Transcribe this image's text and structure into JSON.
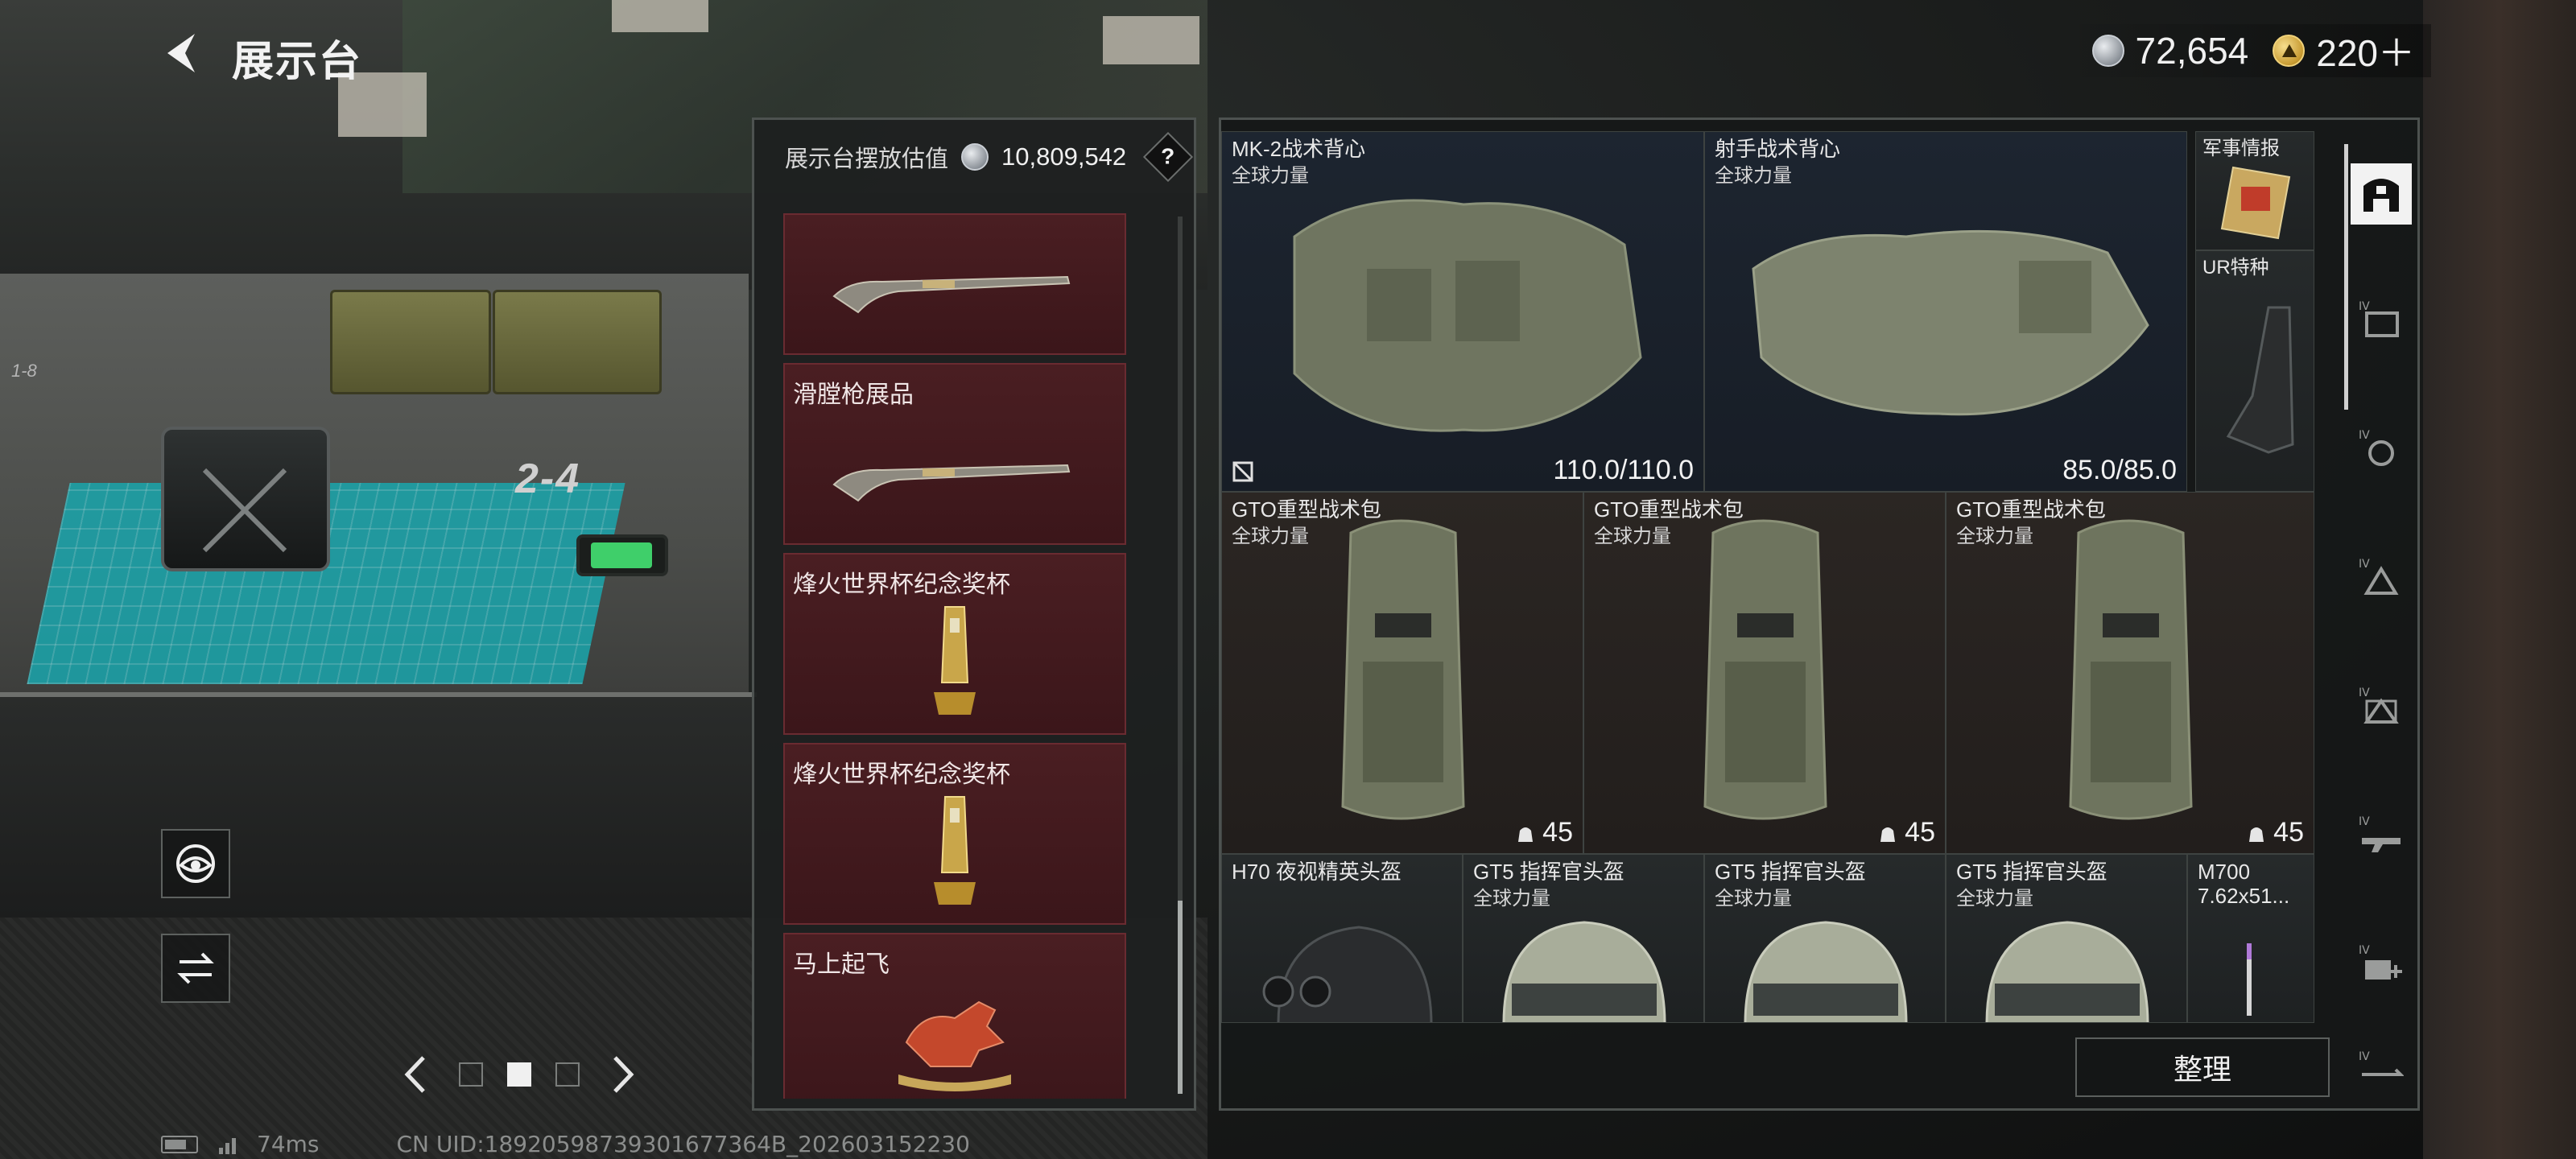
{
  "header": {
    "title": "展示台",
    "currencies": [
      {
        "icon": "silver-coin-icon",
        "value": "72,654"
      },
      {
        "icon": "gold-triangle-coin-icon",
        "value": "220＋"
      }
    ]
  },
  "scene": {
    "grid_label": "2-4",
    "left_label": "1-8"
  },
  "showcase_list": {
    "header_label": "展示台摆放估值",
    "header_value": "10,809,542",
    "help_label": "?",
    "items": [
      {
        "label": "",
        "art": "flintlock-rifle"
      },
      {
        "label": "滑膛枪展品",
        "art": "flintlock-rifle"
      },
      {
        "label": "烽火世界杯纪念奖杯",
        "art": "trophy"
      },
      {
        "label": "烽火世界杯纪念奖杯",
        "art": "trophy"
      },
      {
        "label": "马上起飞",
        "art": "horse-statue"
      }
    ]
  },
  "inventory": {
    "row1": [
      {
        "title": "MK-2战术背心",
        "sub": "全球力量",
        "value": "110.0/110.0"
      },
      {
        "title": "射手战术背心",
        "sub": "全球力量",
        "value": "85.0/85.0"
      }
    ],
    "side_items": [
      {
        "title": "军事情报"
      },
      {
        "title": "UR特种"
      }
    ],
    "row2": [
      {
        "title": "GTO重型战术包",
        "sub": "全球力量",
        "count": "45"
      },
      {
        "title": "GTO重型战术包",
        "sub": "全球力量",
        "count": "45"
      },
      {
        "title": "GTO重型战术包",
        "sub": "全球力量",
        "count": "45"
      }
    ],
    "row3": [
      {
        "title": "H70 夜视精英头盔",
        "sub": ""
      },
      {
        "title": "GT5 指挥官头盔",
        "sub": "全球力量"
      },
      {
        "title": "GT5 指挥官头盔",
        "sub": "全球力量"
      },
      {
        "title": "GT5 指挥官头盔",
        "sub": "全球力量"
      },
      {
        "title": "M700",
        "sub": "7.62x51..."
      }
    ],
    "sort_label": "整理"
  },
  "categories": [
    {
      "icon": "all-items-icon",
      "active": true
    },
    {
      "icon": "armor-category-icon"
    },
    {
      "icon": "backpack-category-icon"
    },
    {
      "icon": "helmet-category-icon"
    },
    {
      "icon": "chest-rig-category-icon"
    },
    {
      "icon": "weapon-category-icon"
    },
    {
      "icon": "add-container-icon"
    },
    {
      "icon": "misc-category-icon"
    }
  ],
  "status": {
    "ping": "74ms",
    "uid": "CN UID:18920598739301677364B_202603152230"
  },
  "colors": {
    "list_card_bg": "#4a1e22",
    "armor_cell_bg": "#1d2530",
    "backpack_cell_bg": "#2b2623",
    "mat_teal": "#1aa6ad"
  }
}
